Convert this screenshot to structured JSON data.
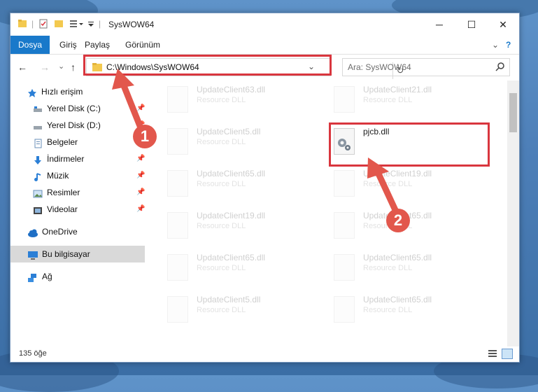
{
  "window": {
    "title": "SysWOW64",
    "minimize_glyph": "─",
    "maximize_glyph": "☐",
    "close_glyph": "✕",
    "help_glyph": "?",
    "collapse_glyph": "⌄"
  },
  "ribbon": {
    "tabs": [
      "Dosya",
      "Giriş",
      "Paylaş",
      "Görünüm"
    ]
  },
  "address": {
    "path": "C:\\Windows\\SysWOW64",
    "back": "←",
    "forward": "→",
    "history": "⌄",
    "up": "↑",
    "dropdown": "⌄",
    "refresh": "↻"
  },
  "search": {
    "placeholder": "Ara: SysWOW64",
    "icon": "search-icon"
  },
  "sidebar": {
    "items": [
      {
        "label": "Hızlı erişim",
        "icon": "star-icon"
      },
      {
        "label": "Yerel Disk (C:)",
        "icon": "drive-icon"
      },
      {
        "label": "Yerel Disk (D:)",
        "icon": "drive-icon"
      },
      {
        "label": "Belgeler",
        "icon": "documents-icon"
      },
      {
        "label": "İndirmeler",
        "icon": "downloads-icon"
      },
      {
        "label": "Müzik",
        "icon": "music-icon"
      },
      {
        "label": "Resimler",
        "icon": "pictures-icon"
      },
      {
        "label": "Videolar",
        "icon": "videos-icon"
      },
      {
        "label": "OneDrive",
        "icon": "cloud-icon"
      },
      {
        "label": "Bu bilgisayar",
        "icon": "computer-icon"
      },
      {
        "label": "Ağ",
        "icon": "network-icon"
      }
    ],
    "pin_glyph": "📌"
  },
  "files": {
    "left": [
      {
        "name": "UpdateClient63.dll",
        "sub": "Resource DLL"
      },
      {
        "name": "UpdateClient5.dll",
        "sub": "Resource DLL"
      },
      {
        "name": "UpdateClient65.dll",
        "sub": "Resource DLL"
      },
      {
        "name": "UpdateClient19.dll",
        "sub": "Resource DLL"
      },
      {
        "name": "UpdateClient65.dll",
        "sub": "Resource DLL"
      },
      {
        "name": "UpdateClient5.dll",
        "sub": "Resource DLL"
      }
    ],
    "right": [
      {
        "name": "UpdateClient21.dll",
        "sub": "Resource DLL"
      },
      {
        "name": "pjcb.dll",
        "sub": ""
      },
      {
        "name": "UpdateClient19.dll",
        "sub": "Resource DLL"
      },
      {
        "name": "UpdateClient65.dll",
        "sub": "Resource DLL"
      },
      {
        "name": "UpdateClient65.dll",
        "sub": "Resource DLL"
      },
      {
        "name": "UpdateClient65.dll",
        "sub": "Resource DLL"
      }
    ]
  },
  "status": {
    "count": "135 öğe"
  },
  "annotations": {
    "badge1": "1",
    "badge2": "2",
    "color": "#e2574c"
  }
}
